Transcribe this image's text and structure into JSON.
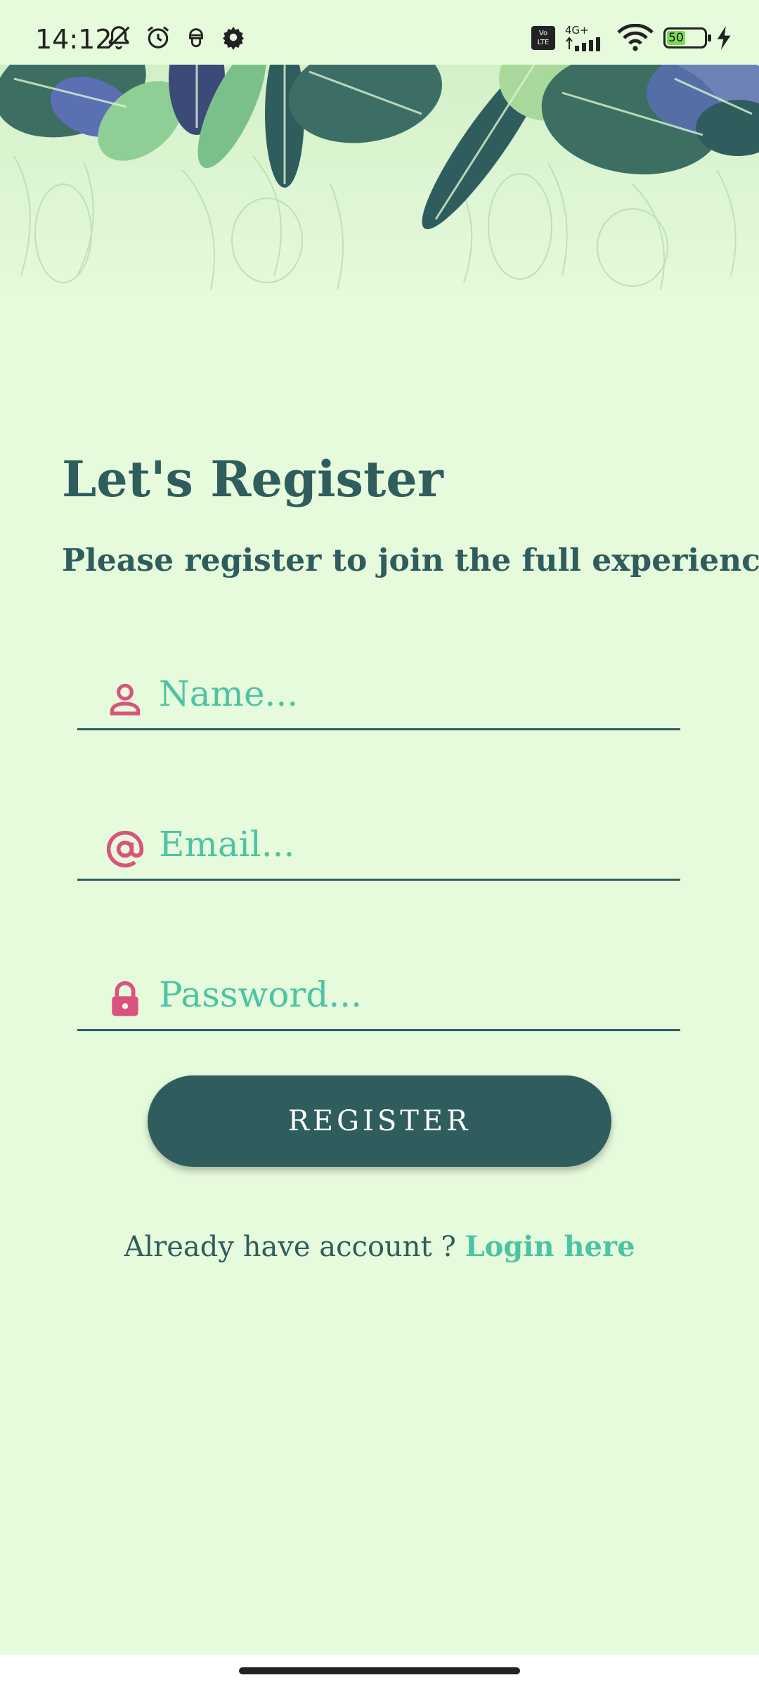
{
  "status_bar": {
    "time": "14:12",
    "left_icons": [
      "bell-off-icon",
      "alarm-icon",
      "privacy-icon",
      "settings-gear-icon"
    ],
    "volte": [
      "Vo",
      "LTE"
    ],
    "network": "4G+",
    "battery": "50",
    "battery_level": 0.5
  },
  "header": {
    "title": "Let's Register",
    "subtitle": "Please register to join the full experience."
  },
  "form": {
    "name_placeholder": "Name...",
    "email_placeholder": "Email...",
    "password_placeholder": "Password...",
    "register_label": "REGISTER"
  },
  "footer": {
    "prompt": "Already have account ? ",
    "login_link": "Login here"
  },
  "colors": {
    "background": "#e6fadc",
    "primary": "#2f5d5d",
    "accent": "#4cc4a4",
    "icon": "#d9537d"
  }
}
